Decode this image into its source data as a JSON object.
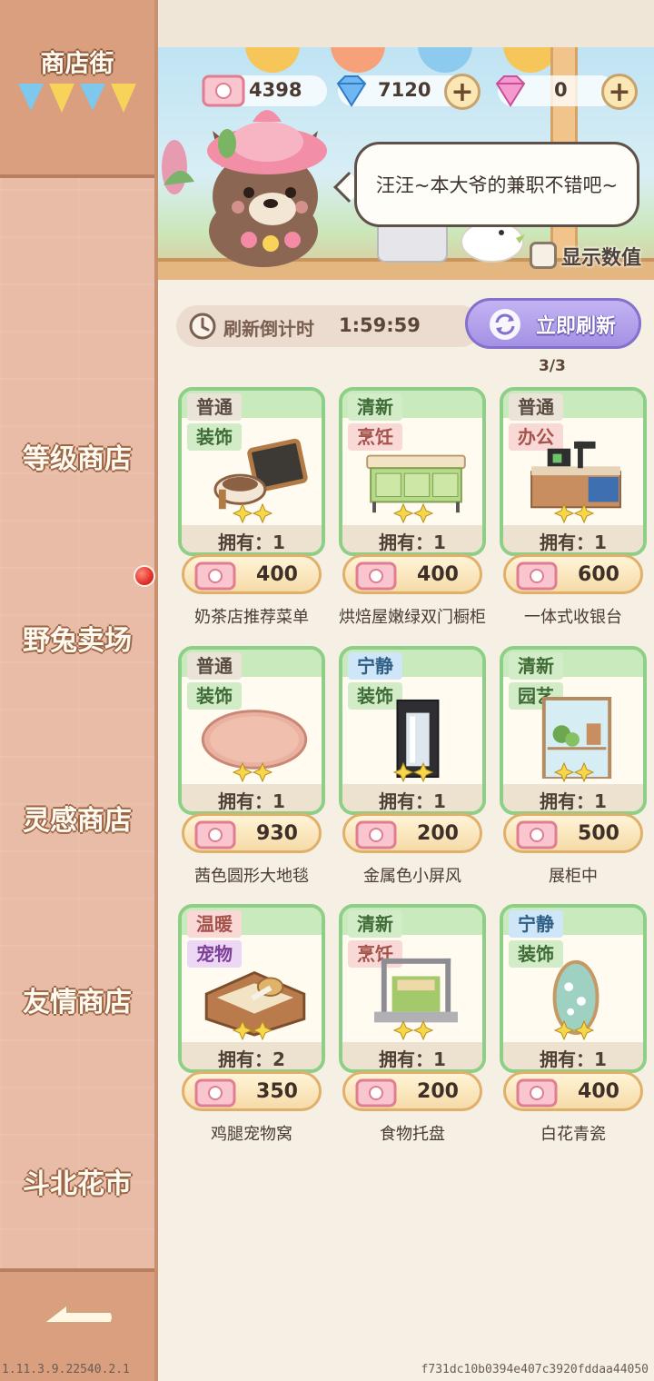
{
  "sidebar": {
    "title": "商店街",
    "items": [
      {
        "label": "等级商店"
      },
      {
        "label": "野兔卖场"
      },
      {
        "label": "灵感商店"
      },
      {
        "label": "友情商店"
      },
      {
        "label": "斗北花市"
      }
    ]
  },
  "footer": {
    "version": "1.11.3.9.22540.2.1",
    "build_hash": "f731dc10b0394e407c3920fddaa44050"
  },
  "currency": {
    "ticket": "4398",
    "diamond": "7120",
    "gem": "0"
  },
  "speech_bubble": "汪汪~本大爷的兼职不错吧~",
  "show_values_label": "显示数值",
  "refresh": {
    "label": "刷新倒计时",
    "countdown": "1:59:59",
    "button_label": "立即刷新",
    "count": "3/3"
  },
  "items": [
    {
      "tags": [
        "普通",
        "装饰"
      ],
      "owned": "拥有：1",
      "price": "400",
      "name": "奶茶店推荐菜单",
      "icon": "menu-board"
    },
    {
      "tags": [
        "清新",
        "烹饪"
      ],
      "owned": "拥有：1",
      "price": "400",
      "name": "烘焙屋嫩绿双门橱柜",
      "icon": "green-cabinet"
    },
    {
      "tags": [
        "普通",
        "办公"
      ],
      "owned": "拥有：1",
      "price": "600",
      "name": "一体式收银台",
      "icon": "cash-register"
    },
    {
      "tags": [
        "普通",
        "装饰"
      ],
      "owned": "拥有：1",
      "price": "930",
      "name": "茜色圆形大地毯",
      "icon": "round-rug"
    },
    {
      "tags": [
        "宁静",
        "装饰"
      ],
      "owned": "拥有：1",
      "price": "200",
      "name": "金属色小屏风",
      "icon": "metal-screen"
    },
    {
      "tags": [
        "清新",
        "园艺"
      ],
      "owned": "拥有：1",
      "price": "500",
      "name": "展柜中",
      "icon": "display-case"
    },
    {
      "tags": [
        "温暖",
        "宠物"
      ],
      "owned": "拥有：2",
      "price": "350",
      "name": "鸡腿宠物窝",
      "icon": "pet-bed"
    },
    {
      "tags": [
        "清新",
        "烹饪"
      ],
      "owned": "拥有：1",
      "price": "200",
      "name": "食物托盘",
      "icon": "food-tray"
    },
    {
      "tags": [
        "宁静",
        "装饰"
      ],
      "owned": "拥有：1",
      "price": "400",
      "name": "白花青瓷",
      "icon": "celadon-vase"
    }
  ]
}
